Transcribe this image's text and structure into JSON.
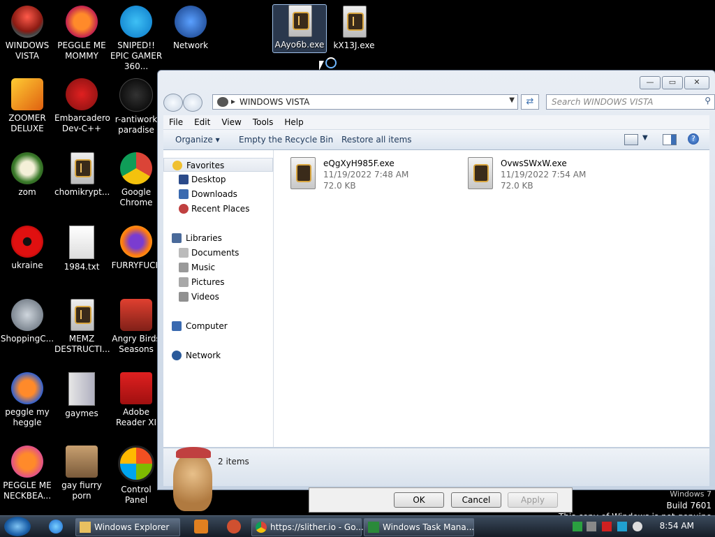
{
  "desktop": {
    "icons": [
      {
        "label": "WINDOWS VISTA"
      },
      {
        "label": "PEGGLE ME MOMMY"
      },
      {
        "label": "SNIPED!! EPIC GAMER 360..."
      },
      {
        "label": "Network"
      },
      {
        "label": "AAyo6b.exe"
      },
      {
        "label": "kX13J.exe"
      },
      {
        "label": "ZOOMER DELUXE"
      },
      {
        "label": "Embarcadero Dev-C++"
      },
      {
        "label": "r-antiwork paradise"
      },
      {
        "label": "zom"
      },
      {
        "label": "chomikrypt..."
      },
      {
        "label": "Google Chrome"
      },
      {
        "label": "ukraine"
      },
      {
        "label": "1984.txt"
      },
      {
        "label": "FURRYFUCK"
      },
      {
        "label": "ShoppingC..."
      },
      {
        "label": "MEMZ DESTRUCTI..."
      },
      {
        "label": "Angry Birds Seasons"
      },
      {
        "label": "peggle my heggle"
      },
      {
        "label": "gaymes"
      },
      {
        "label": "Adobe Reader XI"
      },
      {
        "label": "PEGGLE ME NECKBEA..."
      },
      {
        "label": "gay fiurry porn"
      },
      {
        "label": "Control Panel"
      }
    ]
  },
  "explorer": {
    "title_controls": {
      "minimize": "—",
      "maximize": "▭",
      "close": "✕"
    },
    "address": "WINDOWS VISTA",
    "search_placeholder": "Search WINDOWS VISTA",
    "menu": [
      "File",
      "Edit",
      "View",
      "Tools",
      "Help"
    ],
    "toolbar": {
      "organize": "Organize",
      "empty_bin": "Empty the Recycle Bin",
      "restore_all": "Restore all items"
    },
    "nav": {
      "favorites": "Favorites",
      "desktop": "Desktop",
      "downloads": "Downloads",
      "recent": "Recent Places",
      "libraries": "Libraries",
      "documents": "Documents",
      "music": "Music",
      "pictures": "Pictures",
      "videos": "Videos",
      "computer": "Computer",
      "network": "Network"
    },
    "files": [
      {
        "name": "eQgXyH985F.exe",
        "date": "11/19/2022 7:48 AM",
        "size": "72.0 KB"
      },
      {
        "name": "OvwsSWxW.exe",
        "date": "11/19/2022 7:54 AM",
        "size": "72.0 KB"
      }
    ],
    "status": "2 items"
  },
  "dialog": {
    "ok": "OK",
    "cancel": "Cancel",
    "apply": "Apply"
  },
  "watermark": {
    "line1": "Windows 7",
    "line2": "Build 7601",
    "line3": "This copy of Windows is not genuine"
  },
  "taskbar": {
    "windows_explorer": "Windows Explorer",
    "chrome": "https://slither.io - Go...",
    "task_manager": "Windows Task Mana...",
    "time": "8:54 AM"
  },
  "colors": {
    "accent": "#3d6fb5",
    "window_frame": "#c6d3e3",
    "taskbar": "#1d2733"
  }
}
